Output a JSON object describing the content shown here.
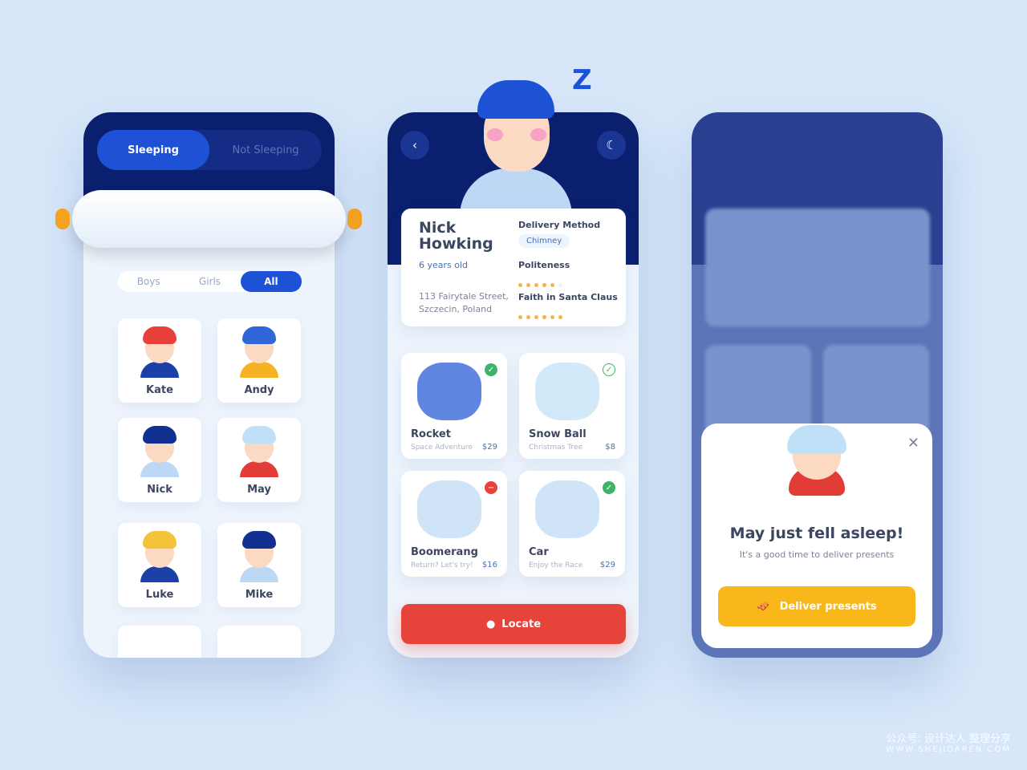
{
  "screen1": {
    "tabs": [
      {
        "label": "Sleeping",
        "active": true
      },
      {
        "label": "Not Sleeping",
        "active": false
      }
    ],
    "filters": [
      {
        "label": "Boys"
      },
      {
        "label": "Girls"
      },
      {
        "label": "All",
        "active": true
      }
    ],
    "kids": [
      {
        "name": "Kate",
        "hair": "#e8403a",
        "shirt": "#1d3fa8"
      },
      {
        "name": "Andy",
        "hair": "#2f66d8",
        "shirt": "#f5b323"
      },
      {
        "name": "Nick",
        "hair": "#12308f",
        "shirt": "#bcd8f5"
      },
      {
        "name": "May",
        "hair": "#bfe0f6",
        "shirt": "#e23c36"
      },
      {
        "name": "Luke",
        "hair": "#f5c33a",
        "shirt": "#1d3fa8"
      },
      {
        "name": "Mike",
        "hair": "#12308f",
        "shirt": "#bcd8f5"
      }
    ]
  },
  "screen2": {
    "back_icon": "chevron-left-icon",
    "night_icon": "moon-icon",
    "profile": {
      "first_name": "Nick",
      "last_name": "Howking",
      "age": "6 years old",
      "address_line1": "113 Fairytale Street,",
      "address_line2": "Szczecin, Poland",
      "delivery_label": "Delivery Method",
      "delivery_value": "Chimney",
      "politeness_label": "Politeness",
      "politeness_rating": 5,
      "politeness_max": 6,
      "faith_label": "Faith in Santa Claus",
      "faith_rating": 6,
      "faith_max": 6
    },
    "products": [
      {
        "name": "Rocket",
        "desc": "Space Adventure",
        "price": "$29",
        "status": "check",
        "color": "#3db36b"
      },
      {
        "name": "Snow Ball",
        "desc": "Christmas Tree",
        "price": "$8",
        "status": "check-outline",
        "color": "#3db36b"
      },
      {
        "name": "Boomerang",
        "desc": "Return? Let's try!",
        "price": "$16",
        "status": "minus",
        "color": "#e8433a"
      },
      {
        "name": "Car",
        "desc": "Enjoy the Race",
        "price": "$29",
        "status": "check",
        "color": "#3db36b"
      }
    ],
    "locate_label": "Locate"
  },
  "screen3": {
    "title": "May just fell asleep!",
    "subtitle": "It's a good time to deliver presents",
    "button_label": "Deliver presents"
  },
  "watermark": {
    "line1": "公众号: 设计达人 整理分享",
    "line2": "WWW.SHEJIDAREN.COM"
  }
}
